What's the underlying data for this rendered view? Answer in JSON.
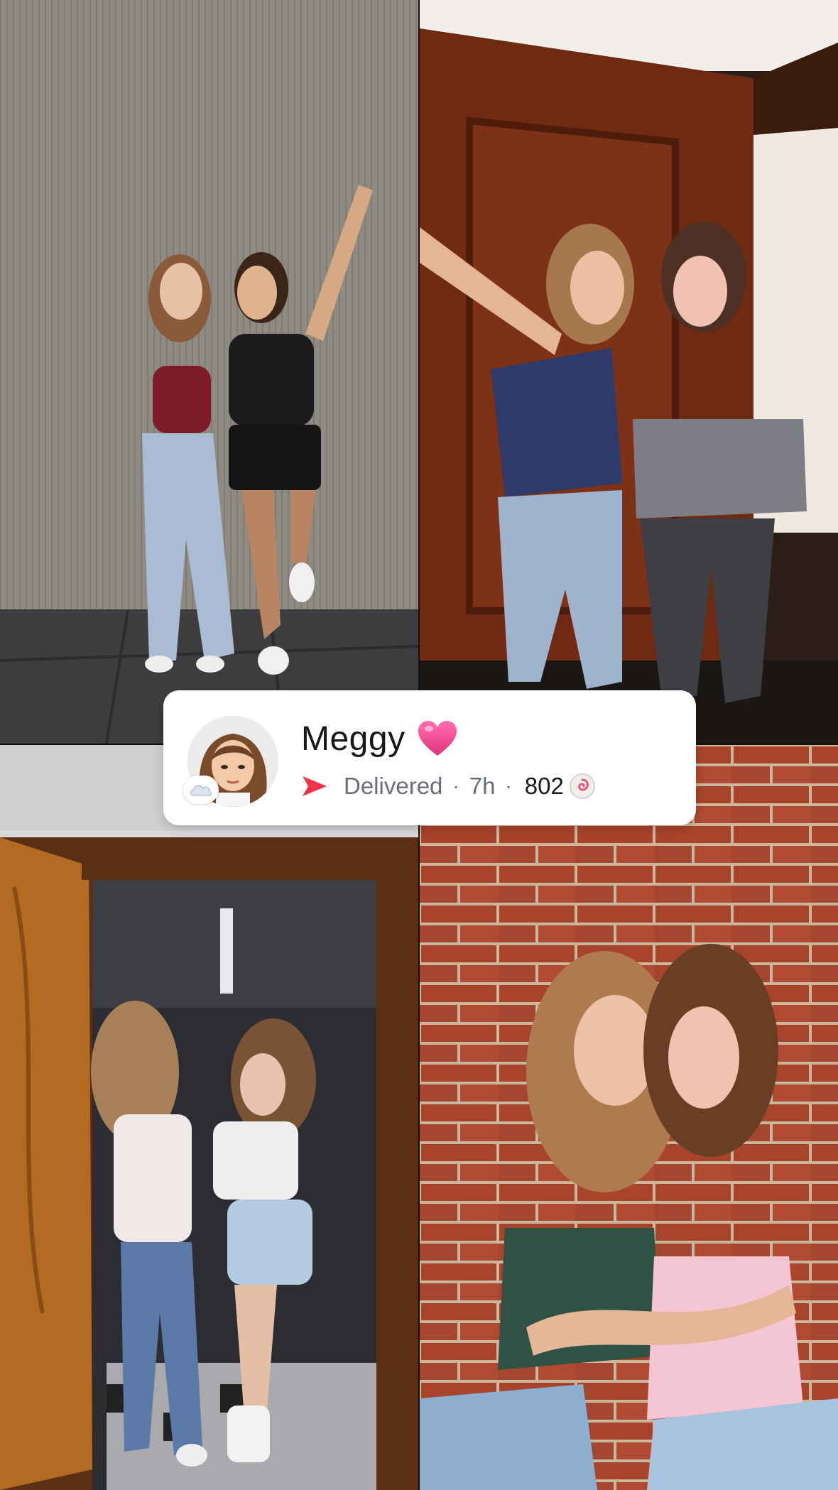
{
  "story": {
    "contact_name": "Meggy",
    "delivery_status": "Delivered",
    "separator": "·",
    "time_ago": "7h",
    "snap_score": "802",
    "icons": {
      "heart": "pink-heart-icon",
      "arrow": "red-snap-arrow-icon",
      "status": "cloud-status-icon",
      "score": "snap-score-icon"
    },
    "colors": {
      "arrow": "#f2314a",
      "heart": "#f0448f",
      "card": "#ffffff"
    }
  },
  "photos": [
    {
      "name": "photo-top-left"
    },
    {
      "name": "photo-top-right"
    },
    {
      "name": "photo-bottom-left"
    },
    {
      "name": "photo-bottom-right"
    }
  ]
}
